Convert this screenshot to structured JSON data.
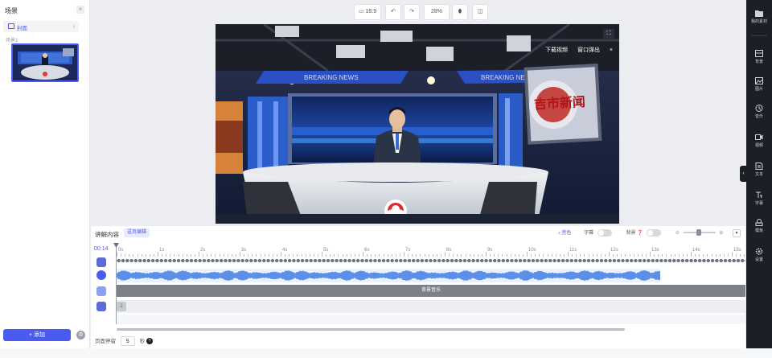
{
  "scene_panel": {
    "title": "场景",
    "collapse_icon": "«",
    "cover_label": "封面",
    "cover_chevron": "›",
    "scene_label": "场景1",
    "add_button": "+ 添加",
    "settings_icon": "⚙"
  },
  "toolbar": {
    "aspect_label": "16:9",
    "zoom": "28%"
  },
  "preview": {
    "download_label": "下载视频",
    "popout_label": "窗口弹出",
    "close_label": "×",
    "banner_left": "BREAKING NEWS",
    "banner_right": "BREAKING NEWS",
    "screen_text": "吉市新闻"
  },
  "timeline": {
    "title": "讲解内容",
    "mode_tag": "逗页编辑",
    "voice_label": "♪ 音色",
    "subtitle_label": "字幕",
    "bgm_label": "背景 ❓",
    "current_time": "00:14",
    "ruler": [
      "0s",
      "1s",
      "2s",
      "3s",
      "4s",
      "5s",
      "6s",
      "7s",
      "8s",
      "9s",
      "10s",
      "11s",
      "12s",
      "13s",
      "14s",
      "15s"
    ],
    "bgm_track_label": "背景音乐",
    "layer_label": "2",
    "duration_label": "页面停留",
    "duration_value": "5",
    "duration_unit": "秒"
  },
  "right_bar": {
    "items": [
      {
        "label": "我的素材",
        "icon": "folder-icon"
      },
      {
        "label": "背景",
        "icon": "background-icon"
      },
      {
        "label": "图片",
        "icon": "image-icon"
      },
      {
        "label": "音乐",
        "icon": "music-icon"
      },
      {
        "label": "视频",
        "icon": "video-icon"
      },
      {
        "label": "文本",
        "icon": "text-icon"
      },
      {
        "label": "字幕",
        "icon": "subtitle-icon"
      },
      {
        "label": "模板",
        "icon": "template-icon"
      },
      {
        "label": "设置",
        "icon": "settings-icon"
      }
    ]
  },
  "colors": {
    "accent": "#4b5bf0",
    "sidebar_dark": "#1d1f27",
    "audio_wave": "#5b8fe8",
    "bgm_track": "#7d8089"
  }
}
